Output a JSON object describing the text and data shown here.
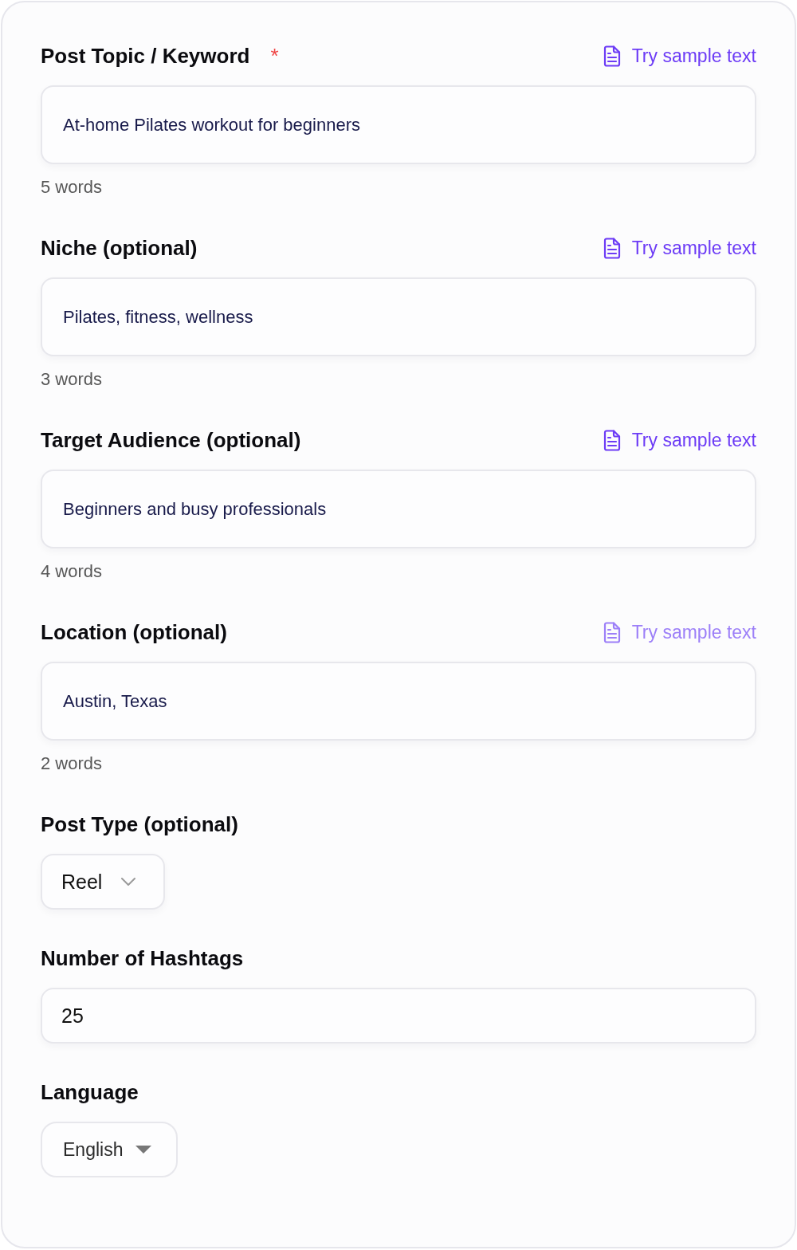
{
  "fields": [
    {
      "kind": "text",
      "label": "Post Topic / Keyword",
      "required_mark": "*",
      "sample_link": {
        "label": "Try sample text",
        "disabled": false
      },
      "value": "At-home Pilates workout for beginners",
      "word_count": "5 words"
    },
    {
      "kind": "text",
      "label": "Niche (optional)",
      "sample_link": {
        "label": "Try sample text",
        "disabled": false
      },
      "value": "Pilates, fitness, wellness",
      "word_count": "3 words"
    },
    {
      "kind": "text",
      "label": "Target Audience (optional)",
      "sample_link": {
        "label": "Try sample text",
        "disabled": false
      },
      "value": "Beginners and busy professionals",
      "word_count": "4 words"
    },
    {
      "kind": "text",
      "label": "Location (optional)",
      "sample_link": {
        "label": "Try sample text",
        "disabled": true
      },
      "value": "Austin, Texas",
      "word_count": "2 words"
    },
    {
      "kind": "select",
      "label": "Post Type (optional)",
      "value": "Reel"
    },
    {
      "kind": "number",
      "label": "Number of Hashtags",
      "value": "25"
    },
    {
      "kind": "dropdown",
      "label": "Language",
      "value": "English"
    }
  ]
}
